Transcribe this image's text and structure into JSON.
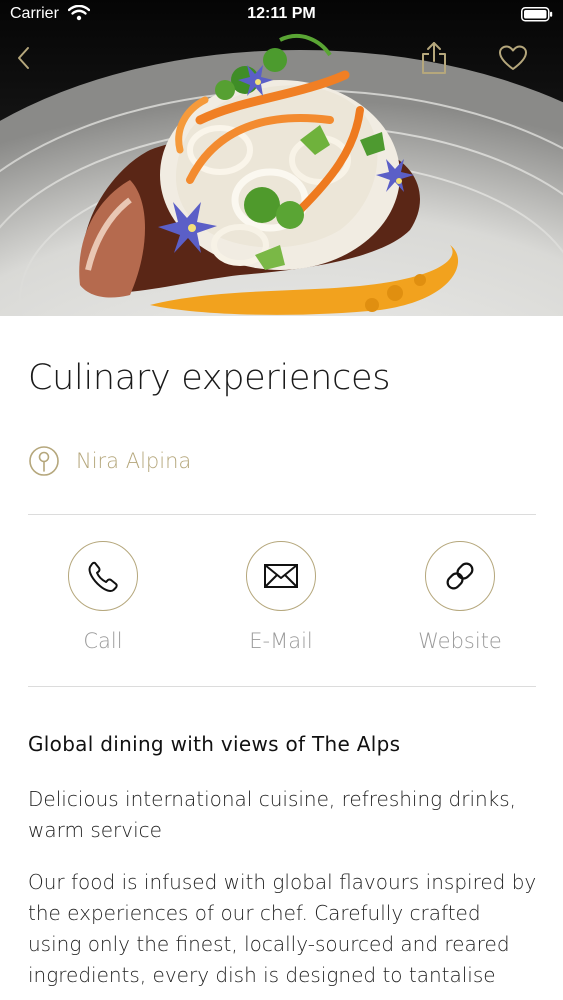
{
  "status_bar": {
    "carrier": "Carrier",
    "time": "12:11 PM"
  },
  "nav": {
    "back_icon": "chevron-left-icon",
    "share_icon": "share-icon",
    "favorite_icon": "heart-icon"
  },
  "venue": {
    "title": "Culinary experiences",
    "location": "Nira Alpina"
  },
  "actions": [
    {
      "label": "Call",
      "icon": "phone-icon"
    },
    {
      "label": "E-Mail",
      "icon": "envelope-icon"
    },
    {
      "label": "Website",
      "icon": "link-icon"
    }
  ],
  "description": {
    "heading": "Global dining with views of The Alps",
    "tagline": "Delicious international cuisine, refreshing drinks, warm service",
    "body": "Our food is infused with global flavours inspired by the experiences of our chef. Carefully crafted using only the finest, locally-sourced and reared ingredients, every dish is designed to tantalise your"
  },
  "colors": {
    "accent": "#b5a77c",
    "action_label": "#9a9a9a",
    "divider": "#dcdcdc"
  }
}
